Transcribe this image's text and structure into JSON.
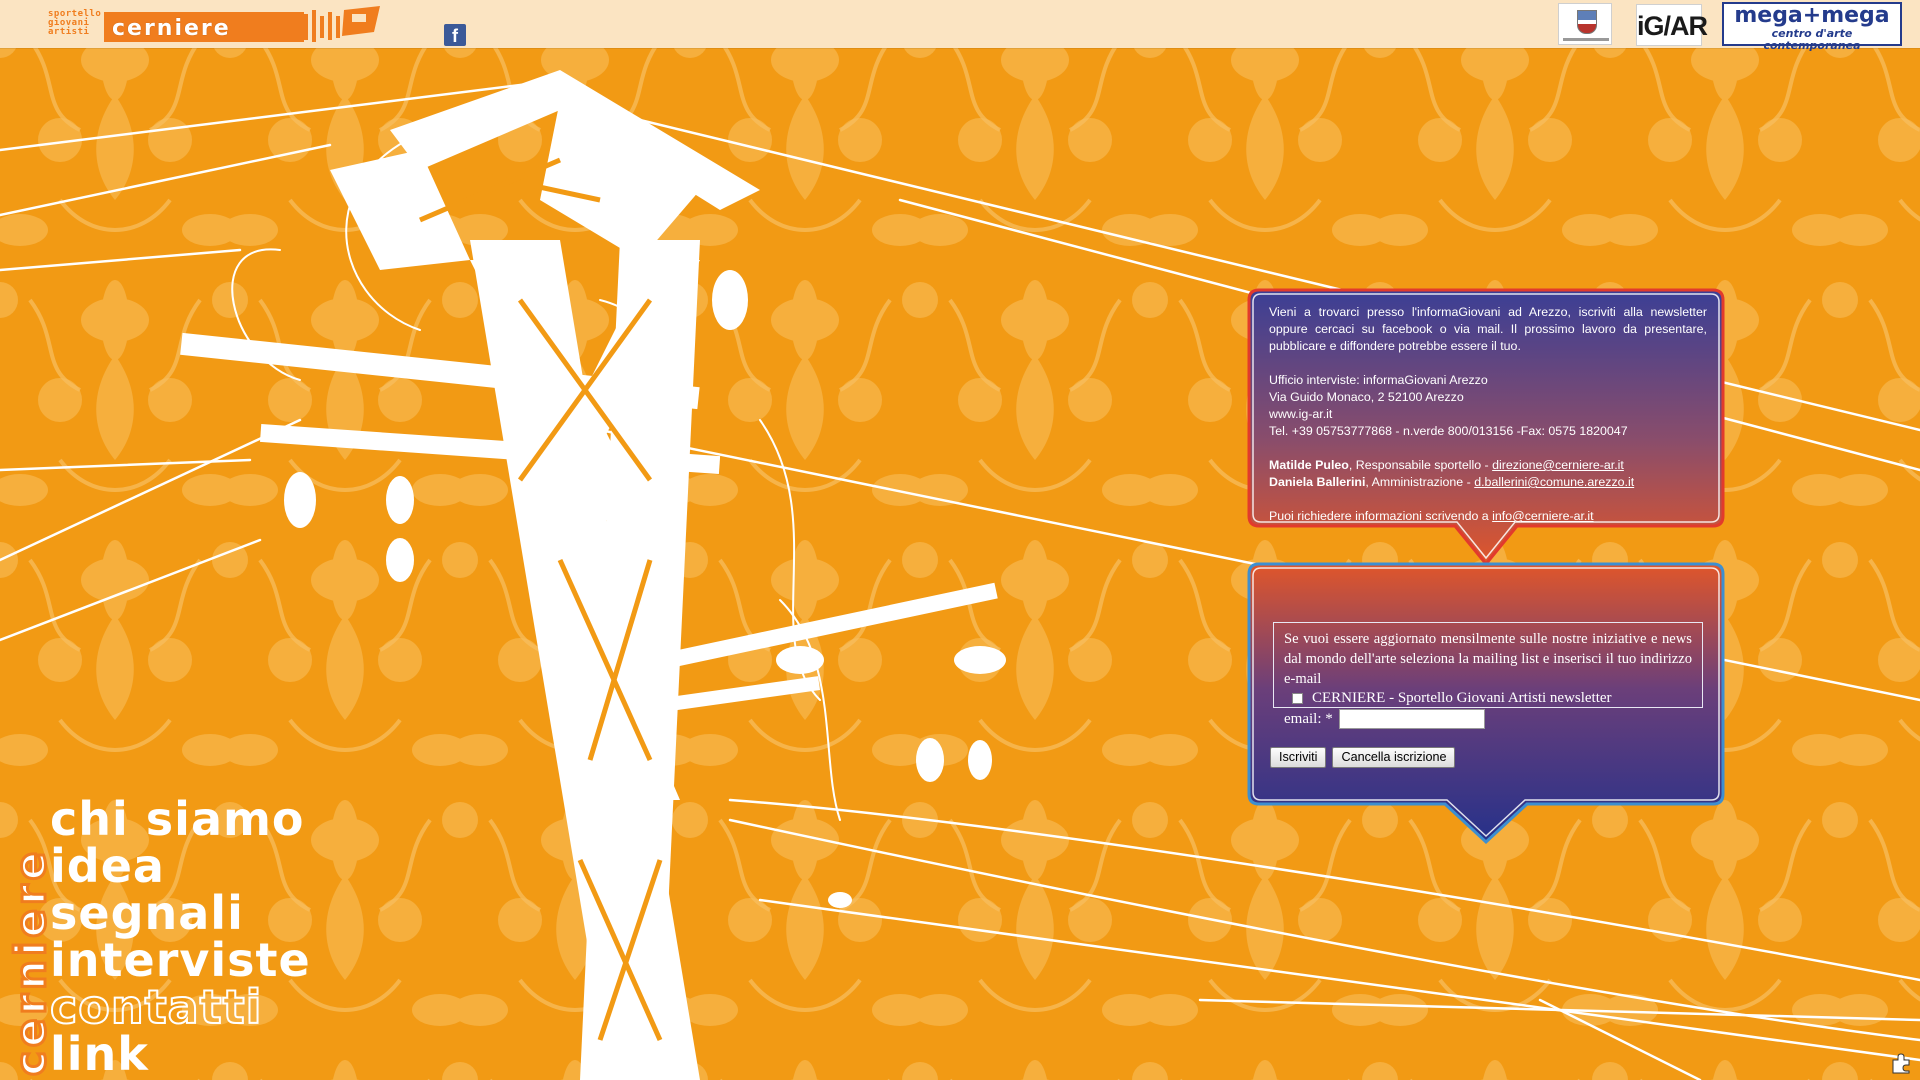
{
  "header": {
    "logo_small_lines": [
      "sportello",
      "giovani",
      "artisti"
    ],
    "logo_word": "cerniere",
    "facebook_glyph": "f",
    "partners": {
      "igar": "iG/AR",
      "megamega_title": "mega+mega",
      "megamega_subtitle": "centro d'arte contemporanea"
    }
  },
  "side_logo": "cerniere",
  "nav": {
    "items": [
      "chi siamo",
      "idea",
      "segnali",
      "interviste",
      "contatti",
      "link"
    ]
  },
  "info": {
    "intro": "Vieni a trovarci presso l'informaGiovani ad Arezzo, iscriviti alla newsletter oppure cercaci su facebook o via mail. Il prossimo lavoro da presentare, pubblicare e diffondere potrebbe essere il tuo.",
    "office_line1": "Ufficio interviste: informaGiovani Arezzo",
    "office_line2": "Via Guido Monaco, 2 52100 Arezzo",
    "office_line3": "www.ig-ar.it",
    "office_line4": "Tel. +39 05753777868 - n.verde 800/013156 -Fax: 0575 1820047",
    "contact1_name": "Matilde Puleo",
    "contact1_role": ", Responsabile sportello - ",
    "contact1_email": "direzione@cerniere-ar.it",
    "contact2_name": "Daniela Ballerini",
    "contact2_role": ", Amministrazione - ",
    "contact2_email": "d.ballerini@comune.arezzo.it",
    "footer_text": "Puoi richiedere informazioni scrivendo a ",
    "footer_email": "info@cerniere-ar.it"
  },
  "newsletter": {
    "intro": "Se vuoi essere aggiornato mensilmente sulle nostre iniziative e news dal mondo dell'arte seleziona la mailing list e inserisci il tuo indirizzo e-mail",
    "list_label": "CERNIERE - Sportello Giovani Artisti newsletter",
    "email_label": "email: *",
    "email_value": "",
    "subscribe_label": "Iscriviti",
    "unsubscribe_label": "Cancella iscrizione"
  },
  "colors": {
    "background_orange": "#f4a01c",
    "topbar": "#fbe4c2",
    "bubble_top": "#3b3f95",
    "bubble_bottom": "#e0562a",
    "bubble_border_red": "#e23a2c",
    "bubble_border_blue": "#3d8fd1",
    "facebook_blue": "#3b5998",
    "megamega_blue": "#243b8c"
  },
  "icons": {
    "facebook": "facebook-icon",
    "corner": "puzzle-icon"
  }
}
